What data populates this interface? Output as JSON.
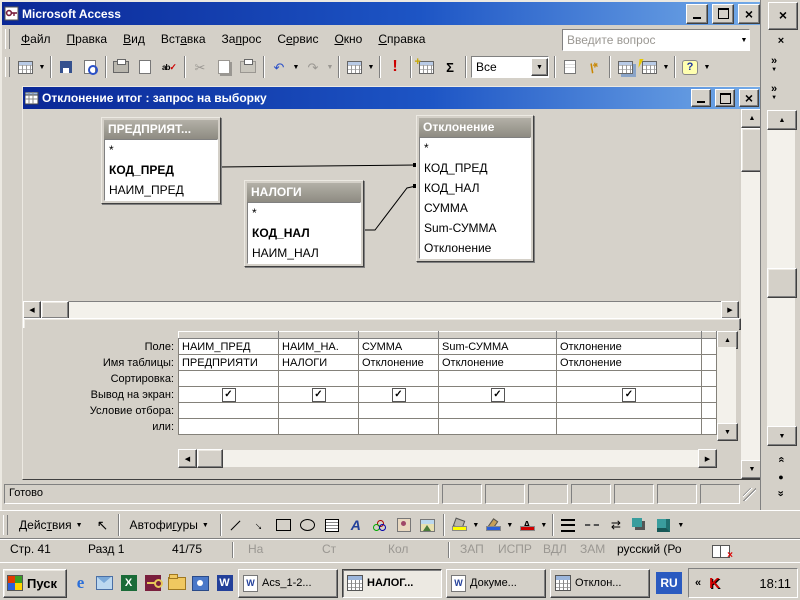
{
  "colors": {
    "titlebar_gradient_start": "#0a2796",
    "titlebar_gradient_end": "#74abe8",
    "chrome": "#d4d0c8",
    "run_button_red": "#cc0000",
    "language_badge_blue": "#2a5ac0",
    "table_header_gray": "#9b988f"
  },
  "access": {
    "title": "Microsoft Access",
    "menu": {
      "items": [
        {
          "label": "Файл",
          "accel": 0
        },
        {
          "label": "Правка",
          "accel": 0
        },
        {
          "label": "Вид",
          "accel": 0
        },
        {
          "label": "Вставка",
          "accel": 3
        },
        {
          "label": "Запрос",
          "accel": 2
        },
        {
          "label": "Сервис",
          "accel": 1
        },
        {
          "label": "Окно",
          "accel": 0
        },
        {
          "label": "Справка",
          "accel": 0
        }
      ],
      "question_box": {
        "placeholder": "Введите вопрос"
      }
    },
    "toolbar": {
      "filter_value": "Все",
      "totals_glyph": "Σ",
      "run_glyph": "!",
      "help_glyph": "?",
      "undo_glyph": "↶",
      "redo_glyph": "↷",
      "cut_glyph": "✂"
    },
    "statusbar": {
      "text": "Готово"
    }
  },
  "query_window": {
    "title": "Отклонение итог : запрос на выборку",
    "diagram": {
      "tables": [
        {
          "name": "ПРЕДПРИЯТ...",
          "fields": [
            {
              "name": "*",
              "bold": false
            },
            {
              "name": "КОД_ПРЕД",
              "bold": true
            },
            {
              "name": "НАИМ_ПРЕД",
              "bold": false
            }
          ]
        },
        {
          "name": "НАЛОГИ",
          "fields": [
            {
              "name": "*",
              "bold": false
            },
            {
              "name": "КОД_НАЛ",
              "bold": true
            },
            {
              "name": "НАИМ_НАЛ",
              "bold": false
            }
          ]
        },
        {
          "name": "Отклонение",
          "fields": [
            {
              "name": "*",
              "bold": false
            },
            {
              "name": "КОД_ПРЕД",
              "bold": false
            },
            {
              "name": "КОД_НАЛ",
              "bold": false
            },
            {
              "name": "СУММА",
              "bold": false
            },
            {
              "name": "Sum-СУММА",
              "bold": false
            },
            {
              "name": "Отклонение",
              "bold": false
            }
          ]
        }
      ]
    },
    "grid": {
      "row_labels": [
        "Поле:",
        "Имя таблицы:",
        "Сортировка:",
        "Вывод на экран:",
        "Условие отбора:",
        "или:"
      ],
      "check_glyph": "✓",
      "columns": [
        {
          "field": "НАИМ_ПРЕД",
          "table": "ПРЕДПРИЯТИ",
          "show": true
        },
        {
          "field": "НАИМ_НА.",
          "table": "НАЛОГИ",
          "show": true
        },
        {
          "field": "СУММА",
          "table": "Отклонение",
          "show": true
        },
        {
          "field": "Sum-СУММА",
          "table": "Отклонение",
          "show": true
        },
        {
          "field": "Отклонение",
          "table": "Отклонение",
          "show": true
        }
      ]
    }
  },
  "word": {
    "drawing_toolbar": {
      "draw_menu": {
        "label": "Действия",
        "accel": 4
      },
      "autoshapes": {
        "label": "Автофигуры",
        "accel": 6
      }
    },
    "statusbar": {
      "page": "Стр. 41",
      "section": "Разд 1",
      "position": "41/75",
      "at_label": "На",
      "line_label": "Ст",
      "col_label": "Кол",
      "flags": [
        "ЗАП",
        "ИСПР",
        "ВДЛ",
        "ЗАМ"
      ],
      "language": "русский (Ро"
    }
  },
  "taskbar": {
    "start_label": "Пуск",
    "buttons": [
      {
        "label": "Acs_1-2...",
        "icon": "word-document",
        "active": false
      },
      {
        "label": "НАЛОГ...",
        "icon": "access-datasheet",
        "active": true
      },
      {
        "label": "Докуме...",
        "icon": "word-document",
        "active": false
      },
      {
        "label": "Отклон...",
        "icon": "access-query",
        "active": false
      }
    ],
    "tray": {
      "language": "RU",
      "time": "18:11"
    }
  }
}
